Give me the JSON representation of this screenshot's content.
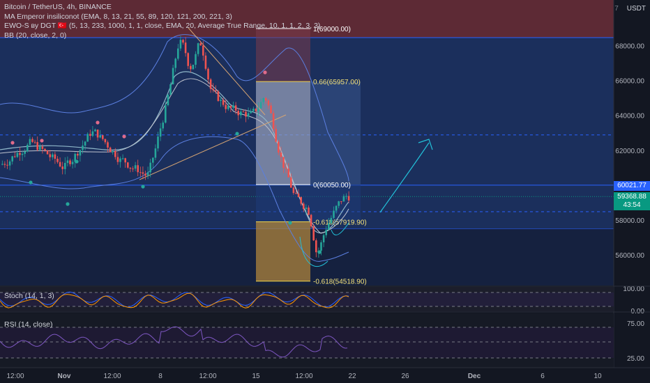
{
  "header": {
    "symbol": "Bitcoin / TetherUS, 4h, BINANCE",
    "indicators": [
      "MA Emperor insiliconot (EMA, 8, 13, 21, 55, 89, 120, 121, 200, 221, 3)",
      "EWO-S ву DGT 🇹🇷 (5, 13, 233, 1000, 1, 1, close, EMA, 20, Average True Range, 10, 1, 1, 2, 3, 3)",
      "BB (20, close, 2, 0)"
    ],
    "currency": "USDT",
    "currency_prefix": "7"
  },
  "price_axis": {
    "ticks": [
      "68000.00",
      "66000.00",
      "64000.00",
      "62000.00",
      "60000.00",
      "58000.00",
      "56000.00"
    ],
    "resistance_label": "60021.77",
    "last_price": "59368.88",
    "countdown": "43:54",
    "colors": {
      "resistance": "#2962ff",
      "last": "#089981"
    }
  },
  "fib_labels": [
    {
      "text": "1(69000.00)",
      "price": 69000
    },
    {
      "text": "0.66(65957.00)",
      "price": 65957
    },
    {
      "text": "0(60050.00)",
      "price": 60050
    },
    {
      "text": "-0.618(57919.90)",
      "price": 57919.9
    },
    {
      "text": "-0.618(54518.90)",
      "price": 54518.9
    }
  ],
  "stoch": {
    "label": "Stoch (14, 1, 3)",
    "ticks": [
      "100.00",
      "0.00"
    ]
  },
  "rsi": {
    "label": "RSI (14, close)",
    "ticks": [
      "75.00",
      "25.00"
    ]
  },
  "time_axis": {
    "labels": [
      "12:00",
      "Nov",
      "12:00",
      "8",
      "12:00",
      "15",
      "12:00",
      "22",
      "26",
      "Dec",
      "6",
      "10"
    ]
  }
}
